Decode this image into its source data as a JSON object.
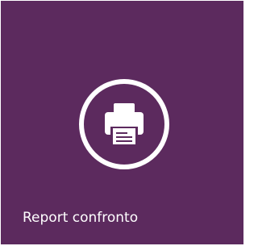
{
  "tile": {
    "label": "Report confronto",
    "icon": "printer-icon",
    "background_color": "#5c2a5e",
    "foreground_color": "#ffffff"
  }
}
